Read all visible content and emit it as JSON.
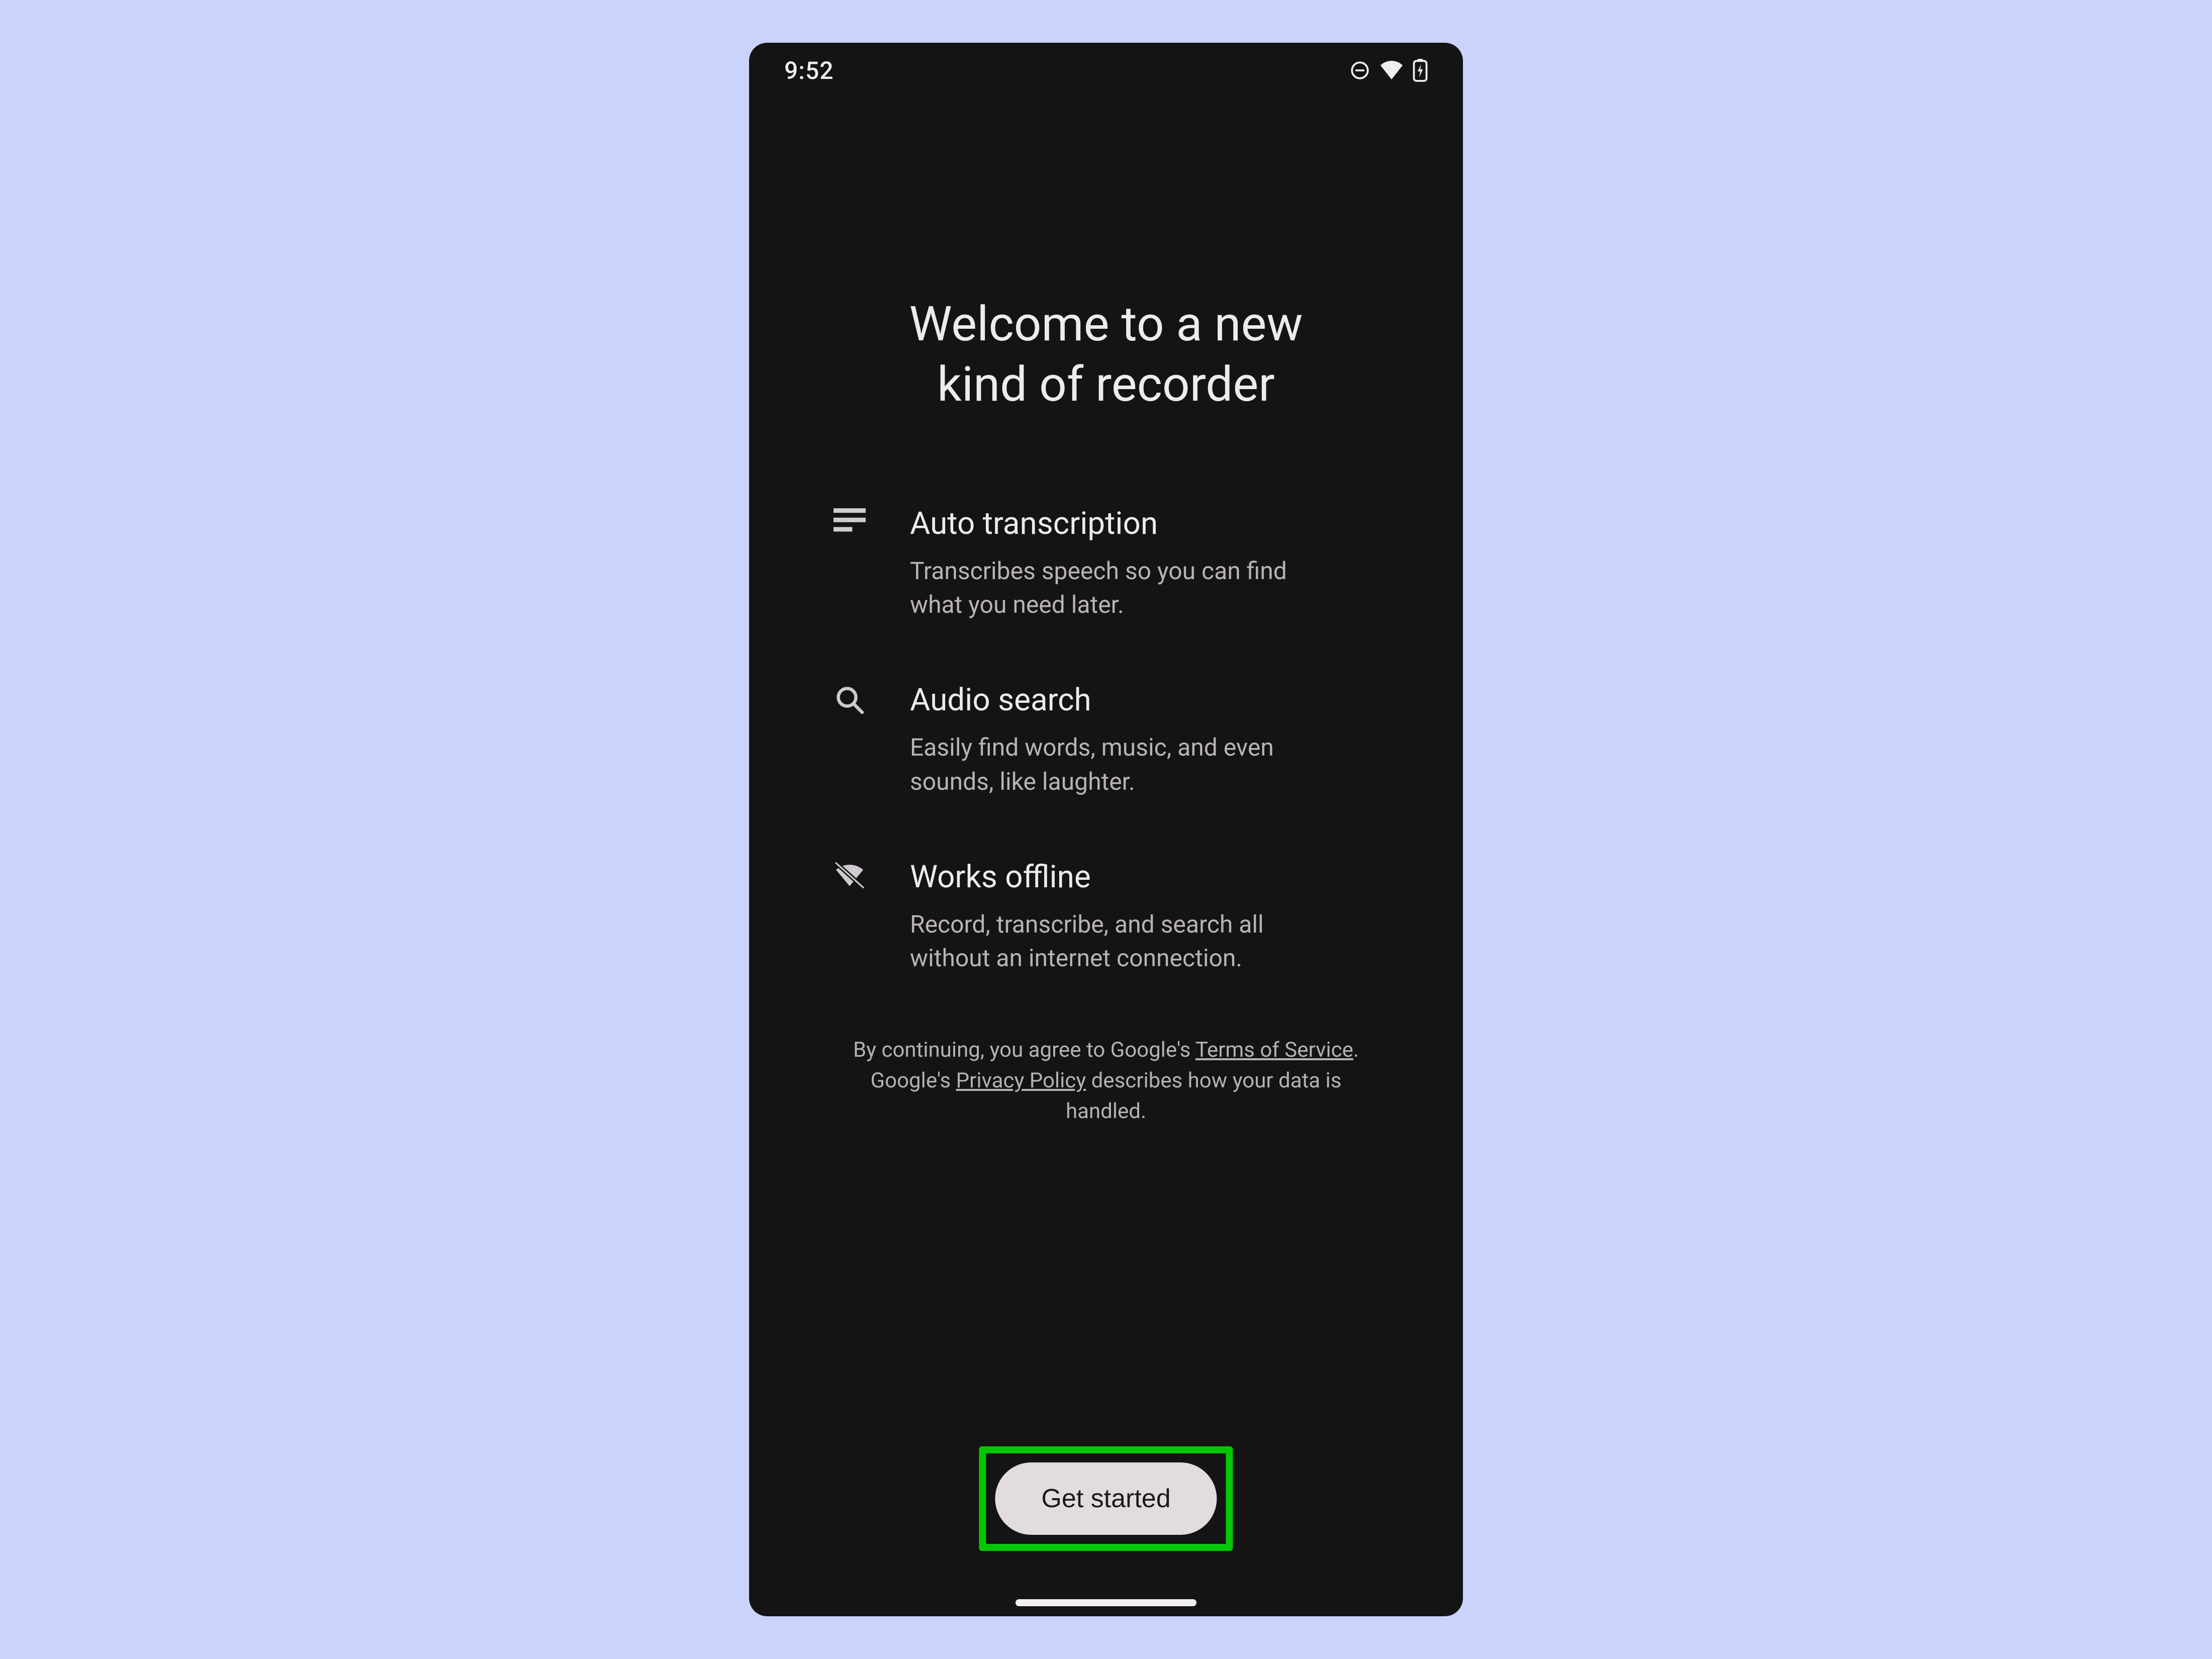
{
  "status": {
    "time": "9:52"
  },
  "title_line1": "Welcome to a new",
  "title_line2": "kind of recorder",
  "features": [
    {
      "title": "Auto transcription",
      "desc": "Transcribes speech so you can find what you need later."
    },
    {
      "title": "Audio search",
      "desc": "Easily find words, music, and even sounds, like laughter."
    },
    {
      "title": "Works offline",
      "desc": "Record, transcribe, and search all without an internet connection."
    }
  ],
  "legal": {
    "pre": "By continuing, you agree to Google's ",
    "tos": "Terms of Service",
    "mid": ". Google's ",
    "pp": "Privacy Policy",
    "post": " describes how your data is handled."
  },
  "cta": {
    "label": "Get started"
  }
}
